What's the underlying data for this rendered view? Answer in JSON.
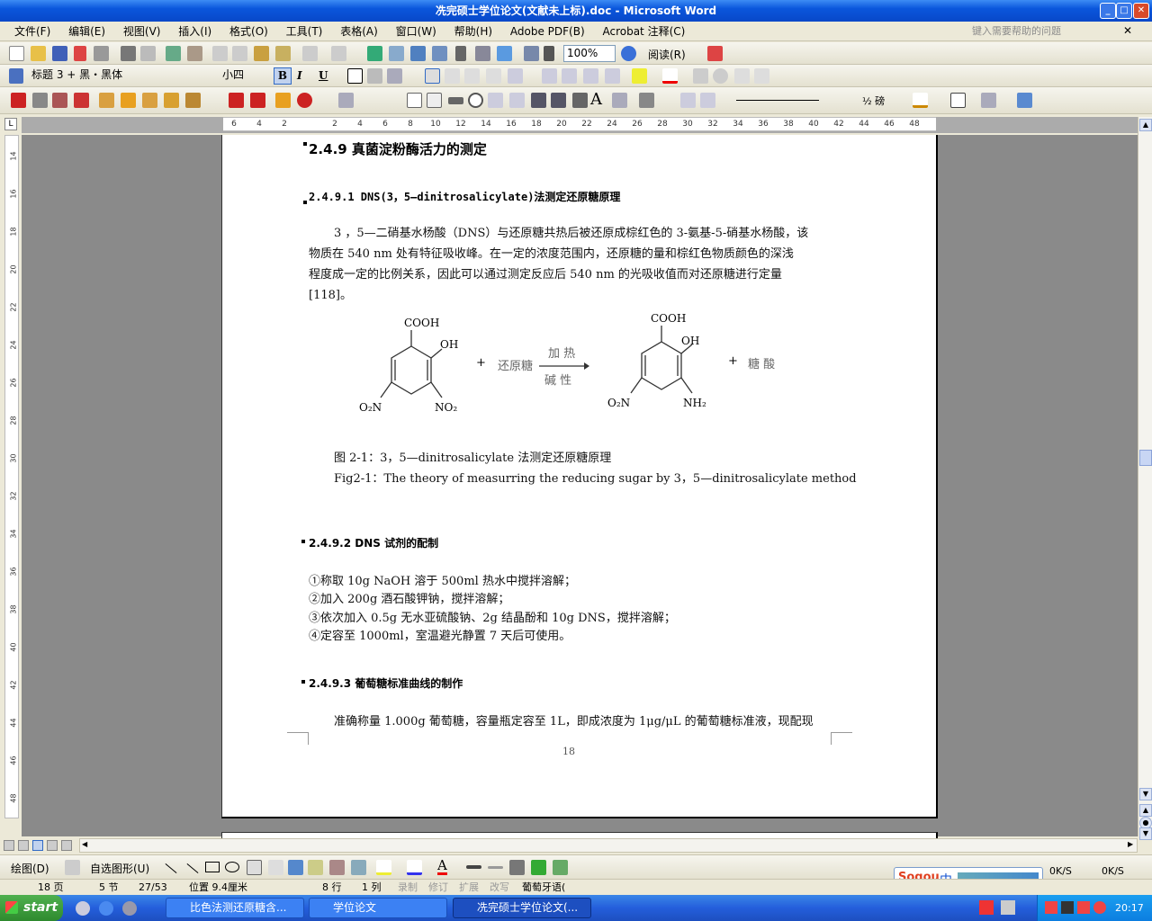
{
  "window": {
    "title": "冼完硕士学位论文(文献未上标).doc - Microsoft Word"
  },
  "menu": {
    "items": [
      "文件(F)",
      "编辑(E)",
      "视图(V)",
      "插入(I)",
      "格式(O)",
      "工具(T)",
      "表格(A)",
      "窗口(W)",
      "帮助(H)",
      "Adobe PDF(B)",
      "Acrobat 注释(C)"
    ],
    "help_placeholder": "键入需要帮助的问题"
  },
  "toolbar": {
    "zoom": "100%",
    "read_label": "阅读(R)",
    "style": "标题 3 + 黑・黑体",
    "font_size": "小四",
    "bold": "B",
    "italic": "I",
    "underline": "U",
    "line_weight": "½ 磅"
  },
  "ruler": {
    "ticks": [
      "6",
      "4",
      "2",
      "",
      "2",
      "4",
      "6",
      "8",
      "10",
      "12",
      "14",
      "16",
      "18",
      "20",
      "22",
      "24",
      "26",
      "28",
      "30",
      "32",
      "34",
      "36",
      "38",
      "40",
      "42",
      "44",
      "46",
      "48"
    ],
    "vticks": [
      "14",
      "16",
      "18",
      "20",
      "22",
      "24",
      "26",
      "28",
      "30",
      "32",
      "34",
      "36",
      "38",
      "40",
      "42",
      "44",
      "46",
      "48"
    ]
  },
  "document": {
    "h249": "2.4.9 真菌淀粉酶活力的测定",
    "h2491": "2.4.9.1 DNS(3，5—dinitrosalicylate)法测定还原糖原理",
    "para1": [
      "3 ，5—二硝基水杨酸（DNS）与还原糖共热后被还原成棕红色的 3-氨基-5-硝基水杨酸，该",
      "物质在  540  nm  处有特征吸收峰。在一定的浓度范围内，还原糖的量和棕红色物质颜色的深浅",
      "程度成一定的比例关系，因此可以通过测定反应后  540  nm  的光吸收值而对还原糖进行定量",
      "[118]。"
    ],
    "figure": {
      "cooh1": "COOH",
      "oh1": "OH",
      "o2n1": "O₂N",
      "no2": "NO₂",
      "plus1": "+",
      "reagent": "还原糖",
      "cond_top": "加 热",
      "cond_bottom": "碱 性",
      "cooh2": "COOH",
      "oh2": "OH",
      "o2n2": "O₂N",
      "nh2": "NH₂",
      "plus2": "+",
      "product": "糖 酸"
    },
    "fig_caption_cn": "图 2-1：3，5—dinitrosalicylate 法测定还原糖原理",
    "fig_caption_en": "Fig2-1：The theory of measurring the reducing sugar by 3，5—dinitrosalicylate method",
    "h2492": "2.4.9.2 DNS 试剂的配制",
    "steps": [
      "①称取 10g NaOH  溶于 500ml  热水中搅拌溶解；",
      "②加入 200g  酒石酸钾钠，搅拌溶解；",
      "③依次加入 0.5g  无水亚硫酸钠、2g  结晶酚和 10g DNS，搅拌溶解；",
      "④定容至 1000ml，室温避光静置 7 天后可使用。"
    ],
    "h2493": "2.4.9.3 葡萄糖标准曲线的制作",
    "para2": "准确称量 1.000g 葡萄糖，容量瓶定容至 1L，即成浓度为 1μg/μL 的葡萄糖标准液，现配现",
    "page_number": "18"
  },
  "drawing": {
    "draw_label": "绘图(D)",
    "autoshape_label": "自选图形(U)"
  },
  "status": {
    "page": "18 页",
    "section": "5 节",
    "pages": "27/53",
    "position": "位置 9.4厘米",
    "line": "8 行",
    "column": "1 列",
    "rec": "录制",
    "trk": "修订",
    "ext": "扩展",
    "ovr": "改写",
    "lang": "葡萄牙语("
  },
  "ime": {
    "label": "中",
    "speed1": "0K/S",
    "speed2": "0K/S"
  },
  "taskbar": {
    "start": "start",
    "tasks": [
      "比色法测还原糖含...",
      "学位论文",
      "冼完硕士学位论文(..."
    ],
    "clock": "20:17"
  },
  "colors": {
    "title_blue": "#0a56dc",
    "taskbar_blue": "#245edb",
    "start_green": "#2e8a2e"
  }
}
